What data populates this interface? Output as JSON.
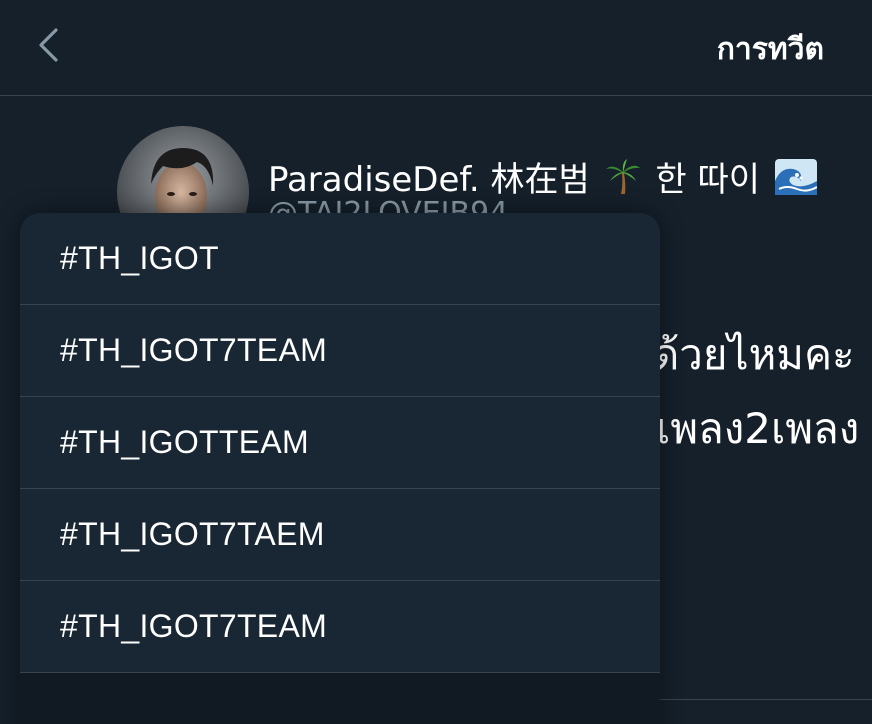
{
  "header": {
    "title": "การทวีต",
    "back_icon": "chevron-left-icon"
  },
  "tweet": {
    "author": {
      "display_name_prefix": "ParadiseDef. 林在범",
      "display_name_middle": "한 따이",
      "emoji_1": "palm-tree-emoji",
      "emoji_2": "wave-emoji",
      "handle": "@TAI2LOVEJB94"
    },
    "text_lines": [
      "ด้วยไหมคะ",
      "เพลง2เพลง"
    ]
  },
  "hashtag_suggestions": [
    {
      "label": "#TH_IGOT"
    },
    {
      "label": "#TH_IGOT7TEAM"
    },
    {
      "label": "#TH_IGOTTEAM"
    },
    {
      "label": "#TH_IGOT7TAEM"
    },
    {
      "label": "#TH_IGOT7TEAM"
    }
  ],
  "colors": {
    "background": "#15202b",
    "dropdown_bg": "#192734",
    "divider": "#38444d",
    "secondary_text": "#8899a6",
    "primary_text": "#ffffff"
  }
}
